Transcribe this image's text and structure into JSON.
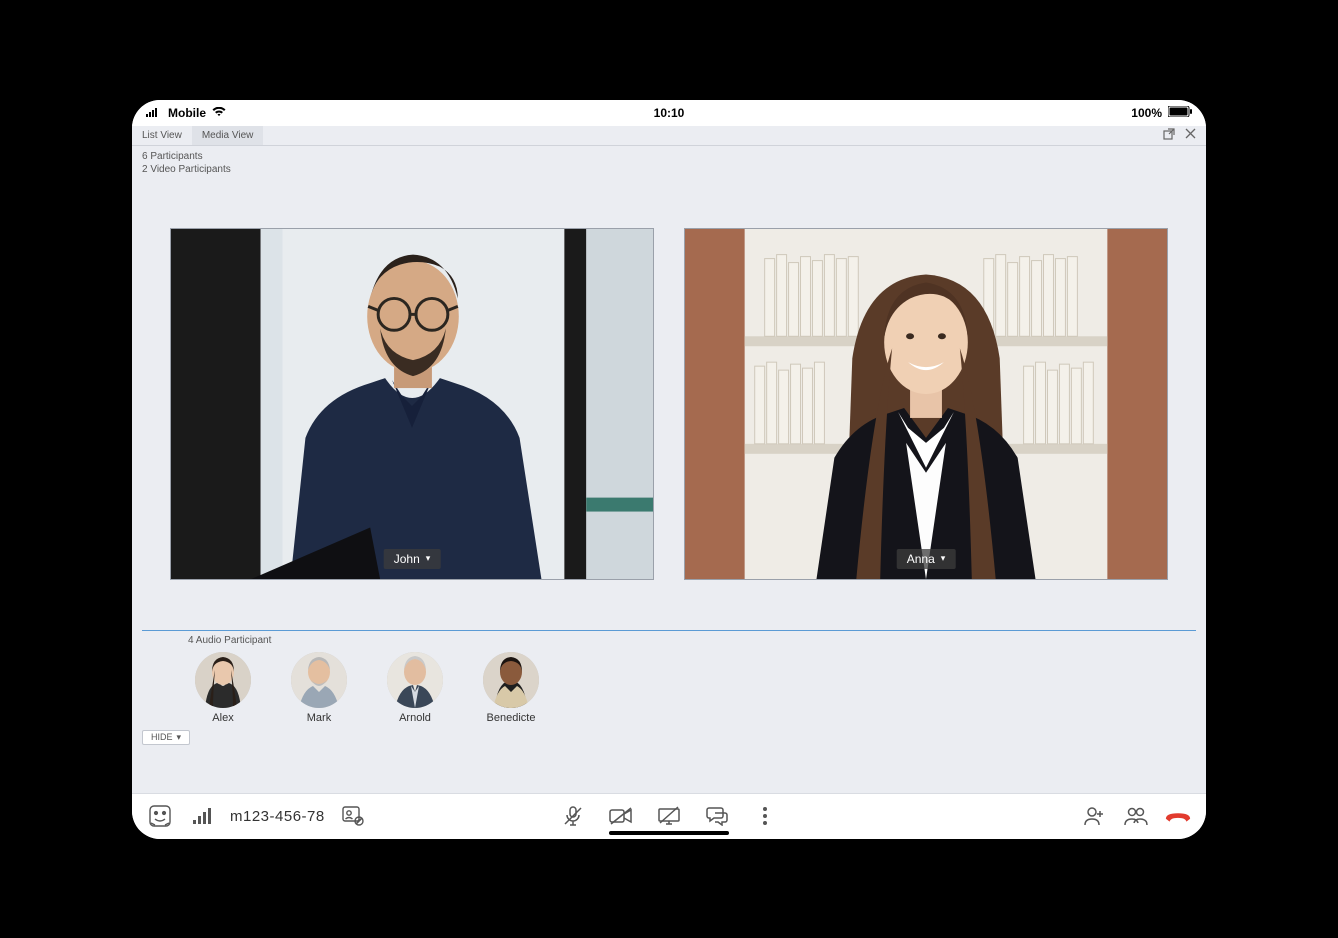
{
  "status": {
    "carrier": "Mobile",
    "time": "10:10",
    "battery": "100%"
  },
  "tabs": {
    "list_view": "List View",
    "media_view": "Media View"
  },
  "info": {
    "participants_line": "6 Participants",
    "video_participants_line": "2 Video Participants"
  },
  "video_participants": [
    {
      "name": "John"
    },
    {
      "name": "Anna"
    }
  ],
  "audio_section": {
    "label": "4 Audio Participant",
    "hide_label": "HIDE"
  },
  "audio_participants": [
    {
      "name": "Alex"
    },
    {
      "name": "Mark"
    },
    {
      "name": "Arnold"
    },
    {
      "name": "Benedicte"
    }
  ],
  "toolbar": {
    "dial_number": "m123-456-78"
  }
}
